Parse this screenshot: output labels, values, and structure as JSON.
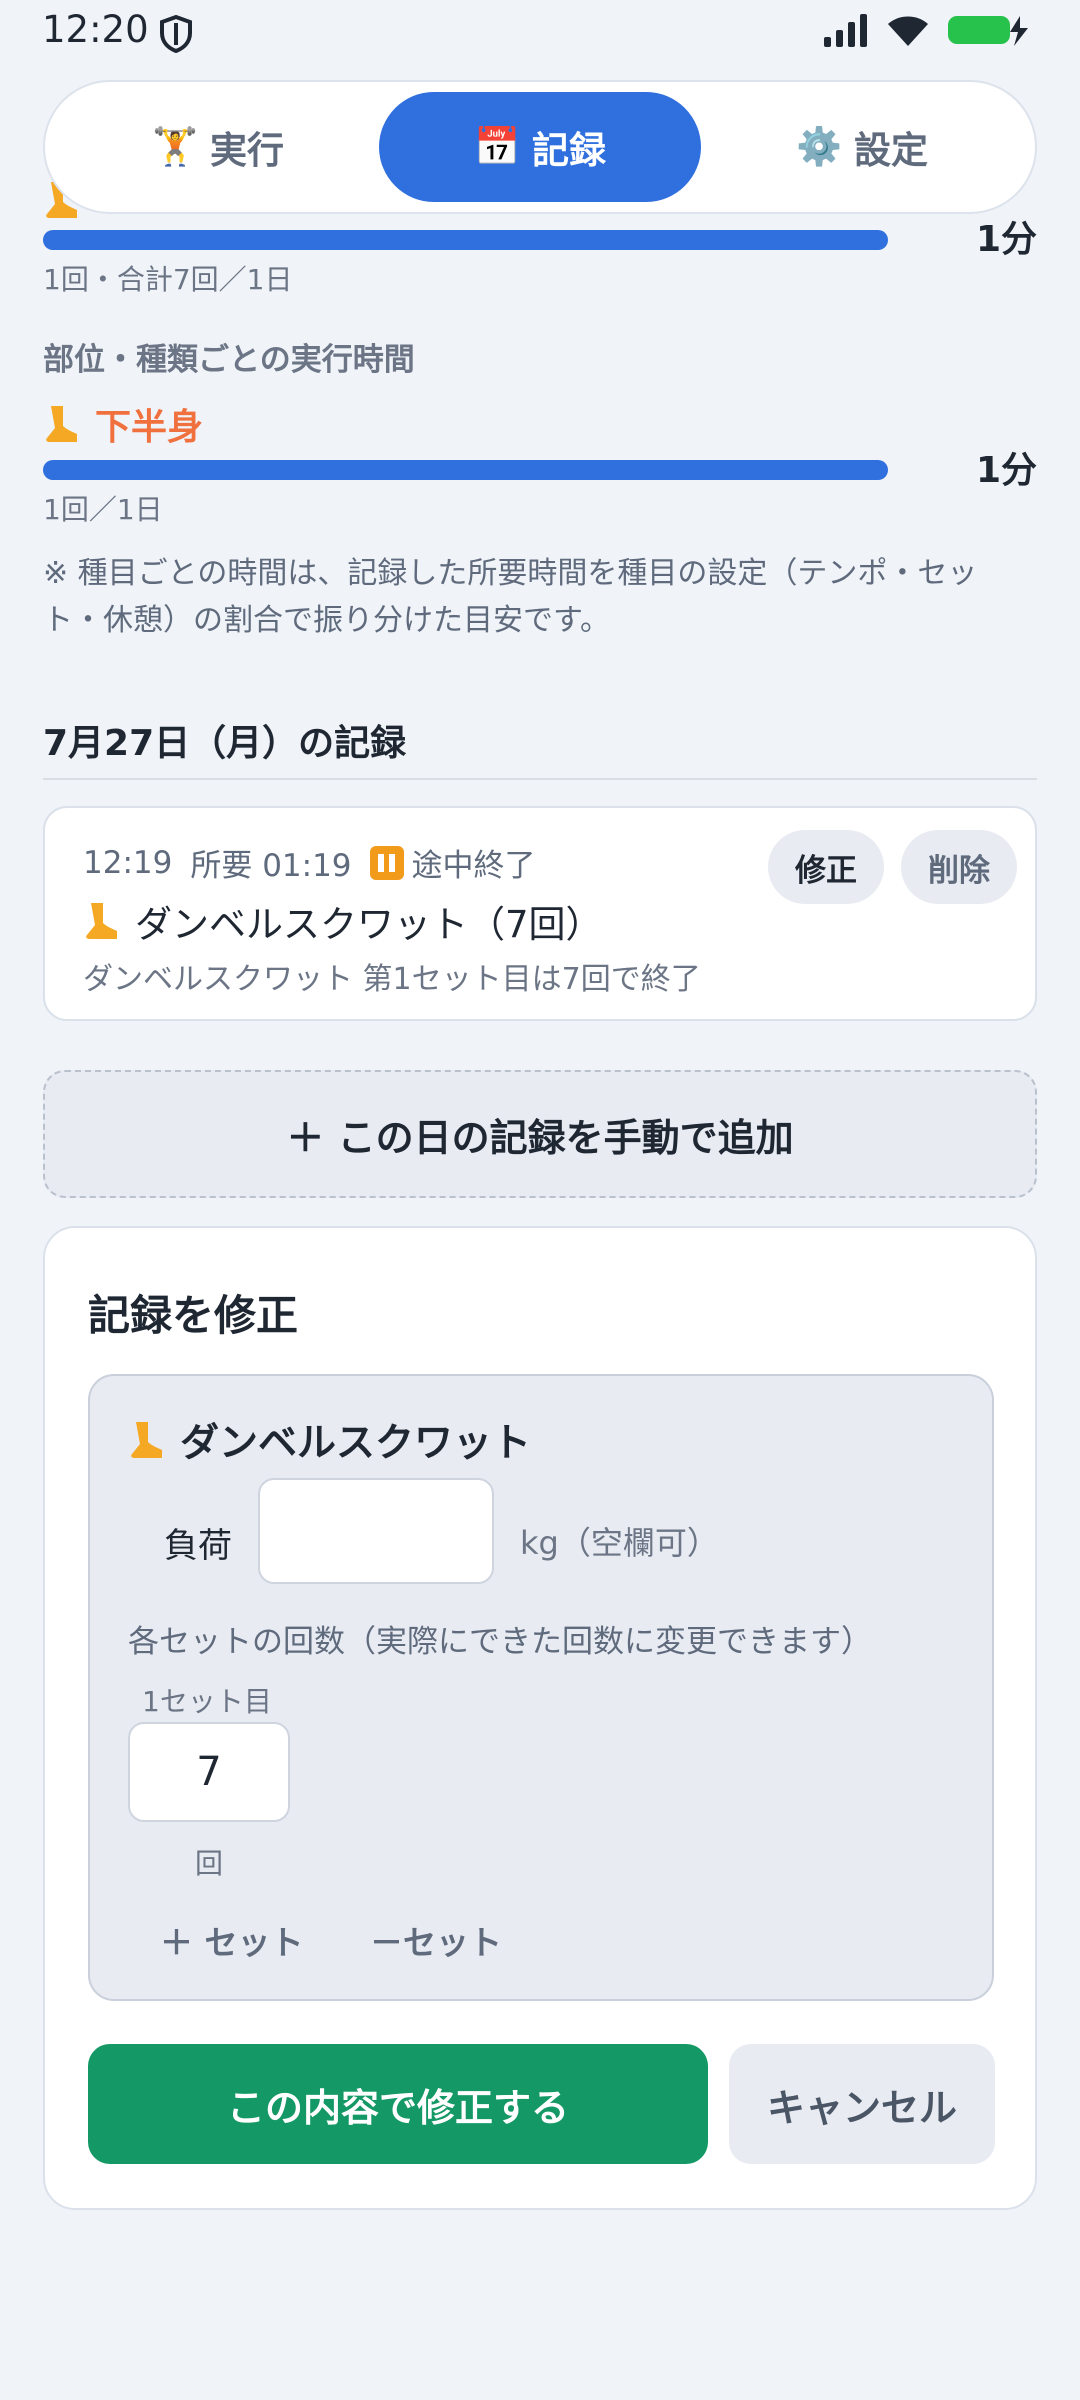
{
  "status": {
    "time": "12:20"
  },
  "tabs": [
    {
      "icon": "🏋",
      "label": "実行"
    },
    {
      "icon": "📅",
      "label": "記録"
    },
    {
      "icon": "⚙️",
      "label": "設定"
    }
  ],
  "summary": {
    "top_value": "1分",
    "top_sub": "1回・合計7回／1日",
    "section_label": "部位・種類ごとの実行時間",
    "category_name": "下半身",
    "category_value": "1分",
    "category_sub": "1回／1日",
    "note": "※ 種目ごとの時間は、記録した所要時間を種目の設定（テンポ・セット・休憩）の割合で振り分けた目安です。"
  },
  "day": {
    "heading": "7月27日（月）の記録"
  },
  "record": {
    "time": "12:19",
    "duration": "所要 01:19",
    "status": "途中終了",
    "title": "ダンベルスクワット（7回）",
    "subtitle": "ダンベルスクワット 第1セット目は7回で終了",
    "edit_label": "修正",
    "delete_label": "削除"
  },
  "add_manual": {
    "label": "＋ この日の記録を手動で追加"
  },
  "edit": {
    "title": "記録を修正",
    "exercise_name": "ダンベルスクワット",
    "load_label": "負荷",
    "load_value": "",
    "load_unit": "kg（空欄可）",
    "sets_description": "各セットの回数（実際にできた回数に変更できます）",
    "sets": [
      {
        "label": "1セット目",
        "reps": "7",
        "unit": "回"
      }
    ],
    "add_set_label": "＋ セット",
    "remove_set_label": "－セット",
    "submit_label": "この内容で修正する",
    "cancel_label": "キャンセル"
  },
  "colors": {
    "accent": "#2f6fde",
    "primary_button": "#149966",
    "category": "#f0703e"
  }
}
